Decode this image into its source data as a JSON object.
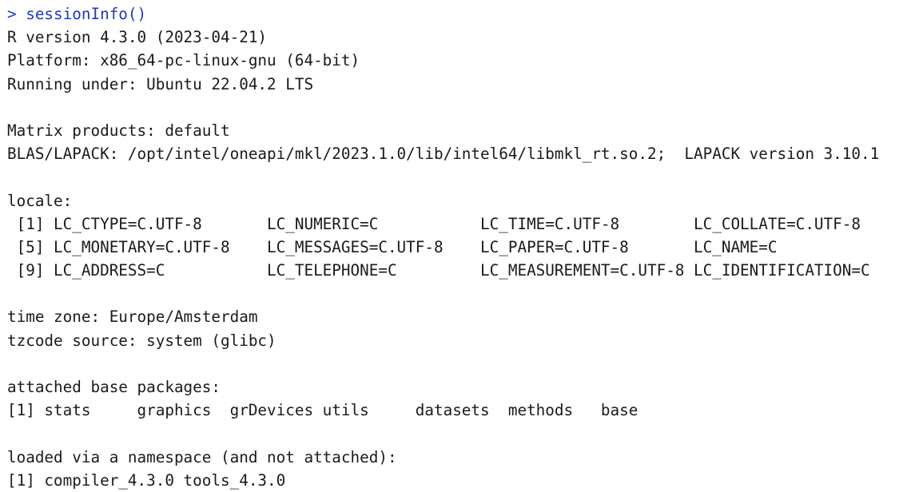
{
  "console": {
    "prompt": "> ",
    "command": "sessionInfo()",
    "lines": [
      "R version 4.3.0 (2023-04-21)",
      "Platform: x86_64-pc-linux-gnu (64-bit)",
      "Running under: Ubuntu 22.04.2 LTS",
      "",
      "Matrix products: default",
      "BLAS/LAPACK: /opt/intel/oneapi/mkl/2023.1.0/lib/intel64/libmkl_rt.so.2;  LAPACK version 3.10.1",
      "",
      "locale:",
      " [1] LC_CTYPE=C.UTF-8       LC_NUMERIC=C           LC_TIME=C.UTF-8        LC_COLLATE=C.UTF-8",
      " [5] LC_MONETARY=C.UTF-8    LC_MESSAGES=C.UTF-8    LC_PAPER=C.UTF-8       LC_NAME=C",
      " [9] LC_ADDRESS=C           LC_TELEPHONE=C         LC_MEASUREMENT=C.UTF-8 LC_IDENTIFICATION=C",
      "",
      "time zone: Europe/Amsterdam",
      "tzcode source: system (glibc)",
      "",
      "attached base packages:",
      "[1] stats     graphics  grDevices utils     datasets  methods   base",
      "",
      "loaded via a namespace (and not attached):",
      "[1] compiler_4.3.0 tools_4.3.0"
    ]
  },
  "colors": {
    "command": "#1f3bb3",
    "output": "#1a1a1a",
    "background": "#ffffff"
  }
}
